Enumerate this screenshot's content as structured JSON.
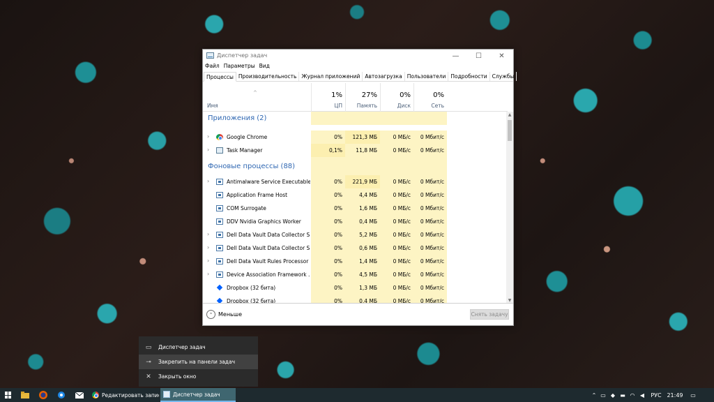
{
  "window": {
    "title": "Диспетчер задач",
    "controls": {
      "minimize": "—",
      "maximize": "☐",
      "close": "✕"
    }
  },
  "menu": [
    "Файл",
    "Параметры",
    "Вид"
  ],
  "tabs": [
    "Процессы",
    "Производительность",
    "Журнал приложений",
    "Автозагрузка",
    "Пользователи",
    "Подробности",
    "Службы"
  ],
  "header": {
    "sort_caret": "^",
    "name_label": "Имя",
    "columns": [
      {
        "pct": "1%",
        "label": "ЦП"
      },
      {
        "pct": "27%",
        "label": "Память"
      },
      {
        "pct": "0%",
        "label": "Диск"
      },
      {
        "pct": "0%",
        "label": "Сеть"
      }
    ]
  },
  "groups": {
    "apps_title": "Приложения (2)",
    "bg_title": "Фоновые процессы (88)"
  },
  "apps": [
    {
      "name": "Google Chrome",
      "cpu": "0%",
      "mem": "121,3 МБ",
      "disk": "0 МБ/с",
      "net": "0 Мбит/с",
      "expand": "›",
      "icon": "chrome-icon"
    },
    {
      "name": "Task Manager",
      "cpu": "0,1%",
      "mem": "11,8 МБ",
      "disk": "0 МБ/с",
      "net": "0 Мбит/с",
      "expand": "›",
      "icon": "task-manager-icon"
    }
  ],
  "processes": [
    {
      "name": "Antimalware Service Executable",
      "cpu": "0%",
      "mem": "221,9 МБ",
      "disk": "0 МБ/с",
      "net": "0 Мбит/с",
      "expand": "›",
      "icon": "service-icon"
    },
    {
      "name": "Application Frame Host",
      "cpu": "0%",
      "mem": "4,4 МБ",
      "disk": "0 МБ/с",
      "net": "0 Мбит/с",
      "expand": "",
      "icon": "window-icon"
    },
    {
      "name": "COM Surrogate",
      "cpu": "0%",
      "mem": "1,6 МБ",
      "disk": "0 МБ/с",
      "net": "0 Мбит/с",
      "expand": "",
      "icon": "window-icon"
    },
    {
      "name": "DDV Nvidia Graphics Worker",
      "cpu": "0%",
      "mem": "0,4 МБ",
      "disk": "0 МБ/с",
      "net": "0 Мбит/с",
      "expand": "",
      "icon": "window-icon"
    },
    {
      "name": "Dell Data Vault Data Collector S...",
      "cpu": "0%",
      "mem": "5,2 МБ",
      "disk": "0 МБ/с",
      "net": "0 Мбит/с",
      "expand": "›",
      "icon": "service-icon"
    },
    {
      "name": "Dell Data Vault Data Collector S...",
      "cpu": "0%",
      "mem": "0,6 МБ",
      "disk": "0 МБ/с",
      "net": "0 Мбит/с",
      "expand": "›",
      "icon": "service-icon"
    },
    {
      "name": "Dell Data Vault Rules Processor",
      "cpu": "0%",
      "mem": "1,4 МБ",
      "disk": "0 МБ/с",
      "net": "0 Мбит/с",
      "expand": "›",
      "icon": "service-icon"
    },
    {
      "name": "Device Association Framework ...",
      "cpu": "0%",
      "mem": "4,5 МБ",
      "disk": "0 МБ/с",
      "net": "0 Мбит/с",
      "expand": "›",
      "icon": "service-icon"
    },
    {
      "name": "Dropbox (32 бита)",
      "cpu": "0%",
      "mem": "1,3 МБ",
      "disk": "0 МБ/с",
      "net": "0 Мбит/с",
      "expand": "",
      "icon": "dropbox-icon"
    },
    {
      "name": "Dropbox (32 бита)",
      "cpu": "0%",
      "mem": "0,4 МБ",
      "disk": "0 МБ/с",
      "net": "0 Мбит/с",
      "expand": "",
      "icon": "dropbox-icon"
    }
  ],
  "footer": {
    "less_label": "Меньше",
    "less_icon": "⌃",
    "end_task_label": "Снять задачу"
  },
  "jumplist": {
    "items": [
      {
        "label": "Диспетчер задач",
        "icon": "task-manager-icon",
        "glyph": "▭"
      },
      {
        "label": "Закрепить на панели задач",
        "icon": "pin-icon",
        "glyph": "⊸"
      },
      {
        "label": "Закрыть окно",
        "icon": "close-icon",
        "glyph": "✕"
      }
    ]
  },
  "taskbar": {
    "apps": [
      {
        "label": "Редактировать запис...",
        "icon": "chrome-icon"
      },
      {
        "label": "Диспетчер задач",
        "icon": "task-manager-icon"
      }
    ],
    "language": "РУС",
    "time": "21:49",
    "colors": {
      "background": "#1e2a2f",
      "active": "#3f6670",
      "accent": "#76b9ed"
    }
  }
}
